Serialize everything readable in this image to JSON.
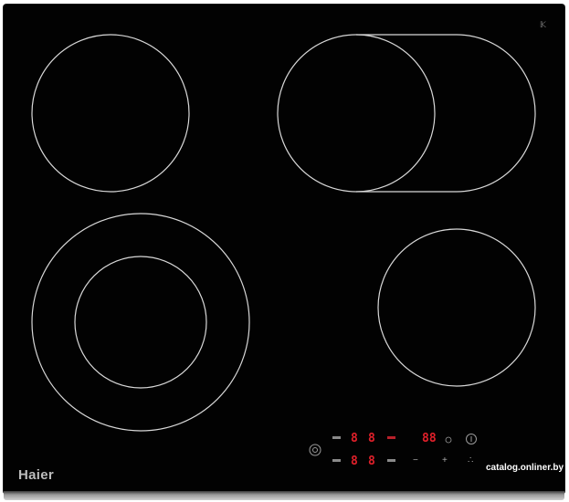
{
  "brand": "Haier",
  "watermark": "catalog.onliner.by",
  "panel": {
    "zone1_display": "8",
    "zone2_display": "8",
    "zone3_display": "8",
    "zone4_display": "8",
    "timer_display": "88",
    "minus_symbol": "−",
    "plus_symbol": "+"
  },
  "colors": {
    "glass": "#020202",
    "ring": "#d8d8d8",
    "display": "#e0202a",
    "brand_text": "#bdbdbd"
  }
}
